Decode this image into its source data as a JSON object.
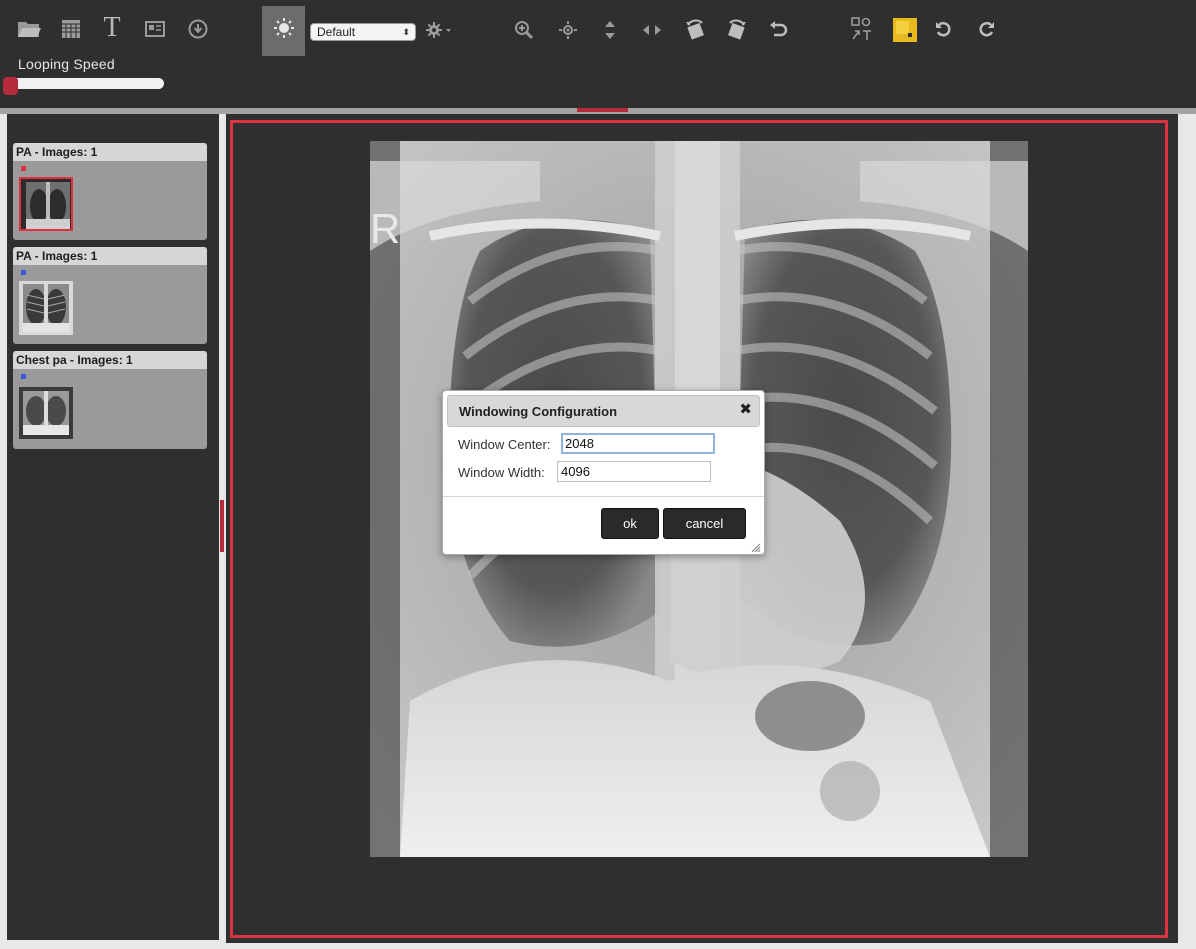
{
  "toolbar": {
    "looping_speed_label": "Looping Speed",
    "looping_speed_fraction": 0.0,
    "preset_select_value": "Default",
    "icons": [
      "open-folder-icon",
      "grid-layout-icon",
      "text-annotation-icon",
      "image-info-icon",
      "download-icon",
      "windowing-sun-icon",
      "settings-gear-icon",
      "zoom-in-icon",
      "pan-icon",
      "flip-vertical-icon",
      "flip-horizontal-icon",
      "rotate-left-icon",
      "rotate-right-icon",
      "undo-icon",
      "measure-tool-icon",
      "color-note-icon",
      "reset-icon",
      "redo-icon"
    ]
  },
  "series": [
    {
      "title": "PA - Images: 1",
      "dot_color": "#e0323e",
      "selected": true
    },
    {
      "title": "PA - Images: 1",
      "dot_color": "#3b5bd6",
      "selected": false
    },
    {
      "title": "Chest pa - Images: 1",
      "dot_color": "#3b5bd6",
      "selected": false
    }
  ],
  "viewer": {
    "orientation_marker": "R",
    "active_border_color": "#dd3340"
  },
  "dialog": {
    "title": "Windowing Configuration",
    "close_glyph": "✖",
    "window_center_label": "Window Center:",
    "window_center_value": "2048",
    "window_width_label": "Window Width:",
    "window_width_value": "4096",
    "ok_label": "ok",
    "cancel_label": "cancel"
  },
  "colors": {
    "toolbar_bg": "#2f2f2f",
    "accent_red": "#b32a3a",
    "dialog_button_bg": "#2a2a2a"
  }
}
